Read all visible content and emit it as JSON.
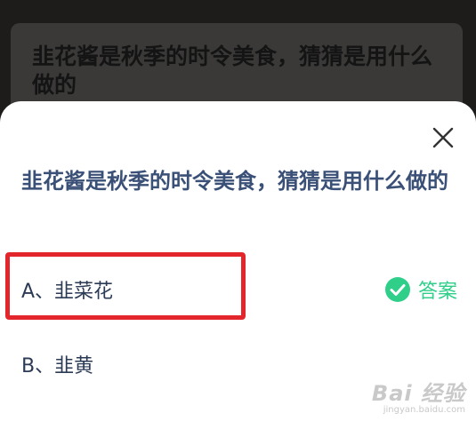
{
  "background": {
    "question": "韭花酱是秋季的时令美食，猜猜是用什么做的"
  },
  "sheet": {
    "question": "韭花酱是秋季的时令美食，猜猜是用什么做的",
    "options": [
      {
        "label": "A、韭菜花",
        "is_answer": true
      },
      {
        "label": "B、韭黄",
        "is_answer": false
      }
    ],
    "answer_label": "答案",
    "close_icon": "close-icon",
    "check_icon": "check-circle-icon"
  },
  "watermark": {
    "logo": "Bai 经验",
    "url": "jingyan.baidu.com"
  },
  "colors": {
    "question_text": "#3a5077",
    "answer_green": "#2fcf8a",
    "highlight_red": "#e3262c",
    "overlay": "#1d1c1a"
  }
}
